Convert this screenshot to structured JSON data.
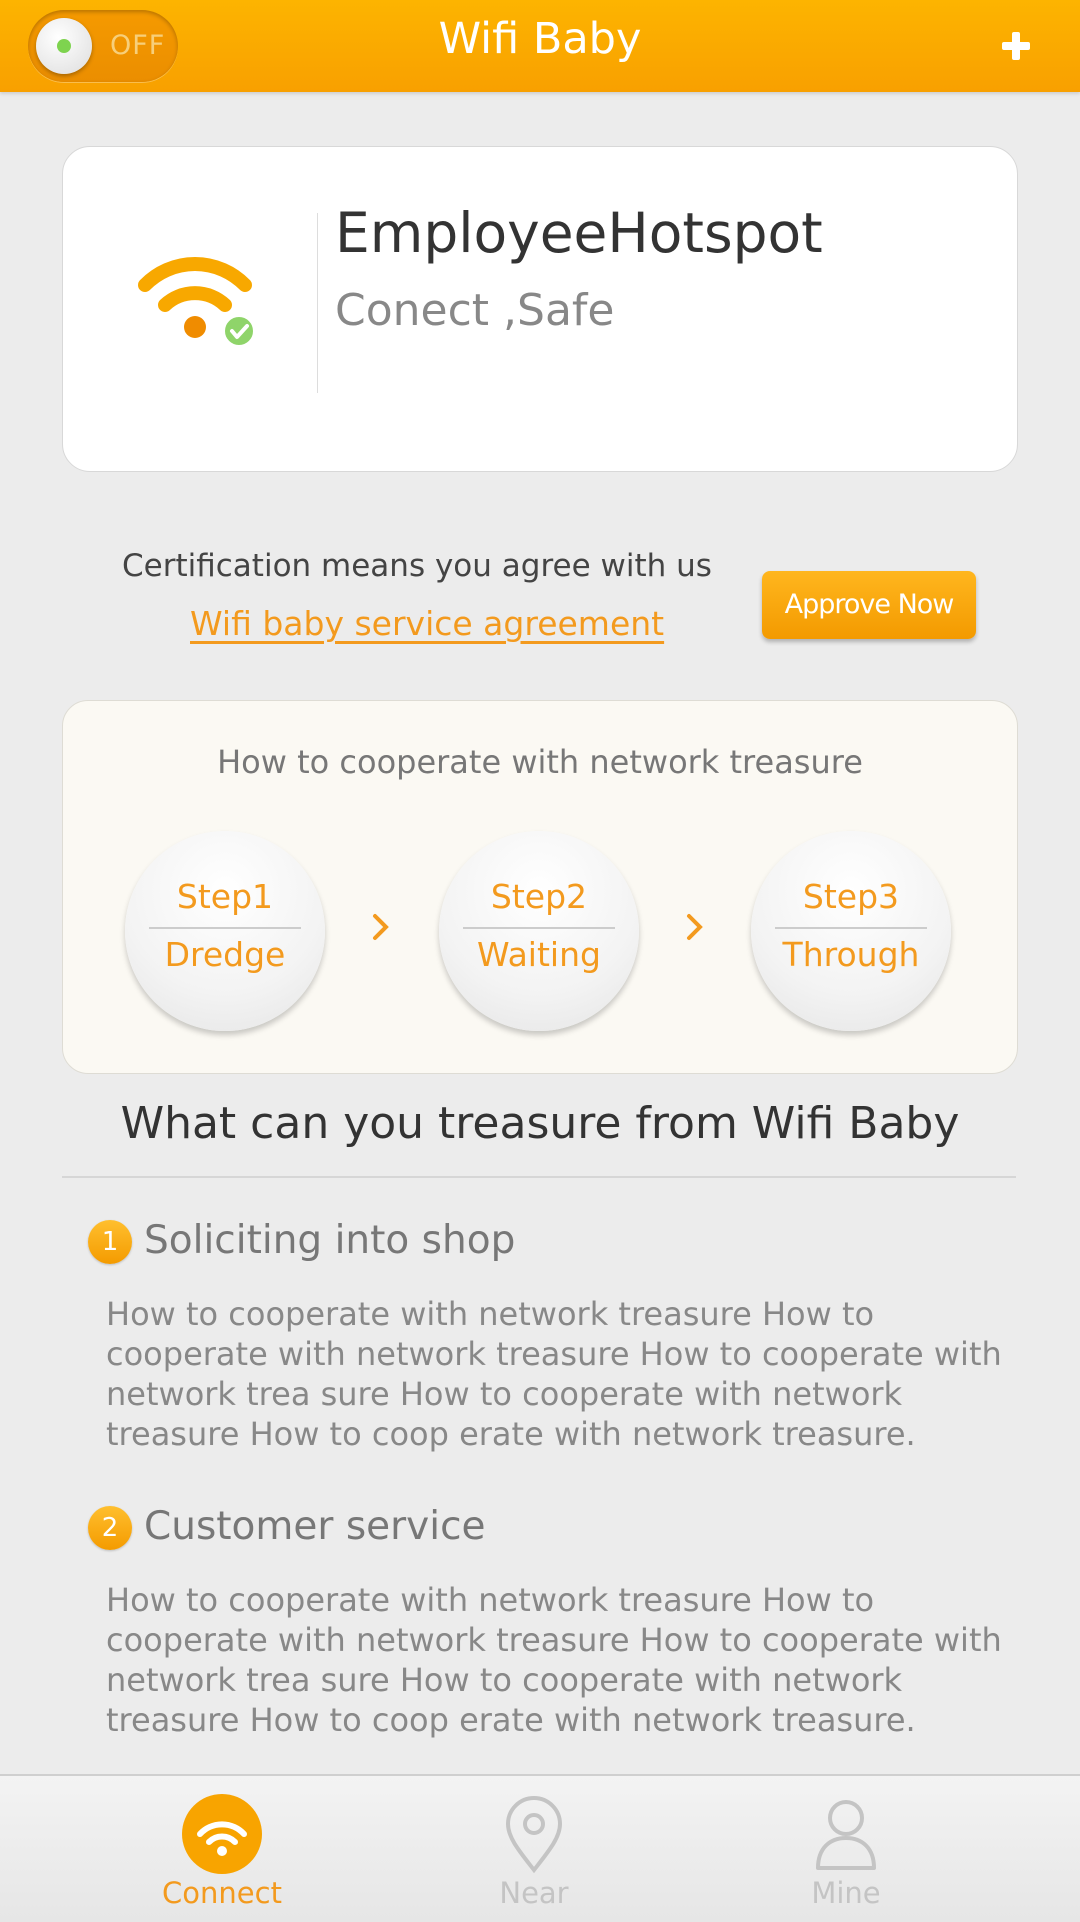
{
  "header": {
    "title": "Wifi Baby",
    "toggle_label": "OFF",
    "add_icon": "plus-icon"
  },
  "network": {
    "name": "EmployeeHotspot",
    "status": "Conect ,Safe",
    "icon": "wifi-connected-icon"
  },
  "certification": {
    "text": "Certification means you agree with us",
    "agreement_link": "Wifi baby service agreement",
    "approve_button": "Approve Now"
  },
  "howto": {
    "title": "How to cooperate with network treasure",
    "steps": [
      {
        "number": "Step1",
        "name": "Dredge"
      },
      {
        "number": "Step2",
        "name": "Waiting"
      },
      {
        "number": "Step3",
        "name": "Through"
      }
    ]
  },
  "treasure": {
    "title": "What can you treasure from Wifi Baby",
    "items": [
      {
        "index": "1",
        "title": "Soliciting into shop",
        "body": "How to cooperate with network treasure How to cooperate with network treasure How to cooperate with network trea sure How to cooperate with network treasure How to coop erate with network treasure."
      },
      {
        "index": "2",
        "title": "Customer service",
        "body": "How to cooperate with network treasure How to cooperate with network treasure How to cooperate with network trea sure How to cooperate with network treasure How to coop erate with network treasure."
      }
    ]
  },
  "tabs": [
    {
      "label": "Connect",
      "icon": "wifi-icon",
      "active": true
    },
    {
      "label": "Near",
      "icon": "location-pin-icon",
      "active": false
    },
    {
      "label": "Mine",
      "icon": "user-icon",
      "active": false
    }
  ],
  "colors": {
    "accent": "#f8a400",
    "link": "#f39a1e",
    "inactive": "#c4c4c4"
  }
}
